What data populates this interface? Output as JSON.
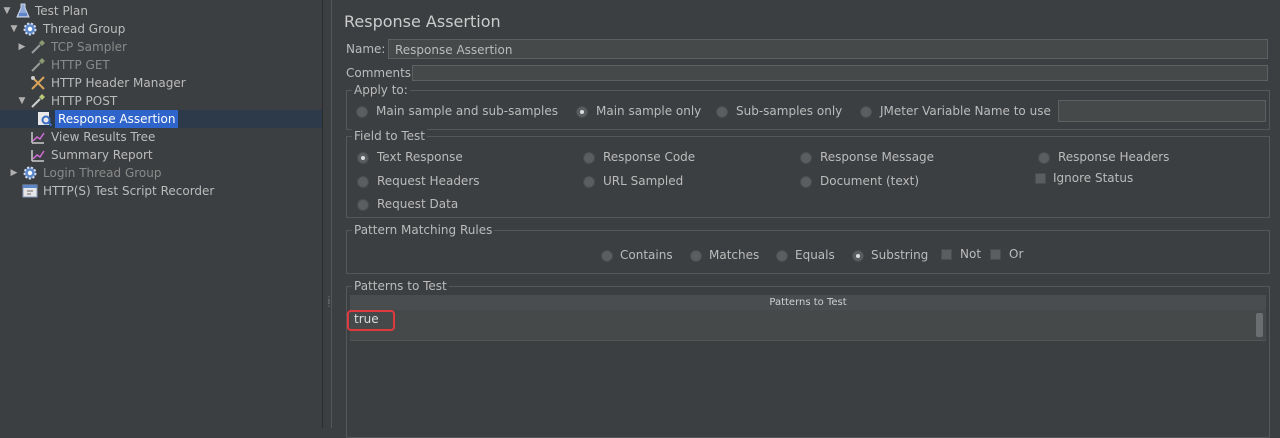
{
  "tree": {
    "items": [
      {
        "label": "Test Plan",
        "icon": "flask-icon"
      },
      {
        "label": "Thread Group",
        "icon": "gear-icon"
      },
      {
        "label": "TCP Sampler",
        "icon": "pipette-icon"
      },
      {
        "label": "HTTP GET",
        "icon": "pipette-icon"
      },
      {
        "label": "HTTP Header Manager",
        "icon": "wrench-icon"
      },
      {
        "label": "HTTP POST",
        "icon": "pipette-icon"
      },
      {
        "label": "Response Assertion",
        "icon": "magnifier-icon"
      },
      {
        "label": "View Results Tree",
        "icon": "chart-icon"
      },
      {
        "label": "Summary Report",
        "icon": "chart-icon"
      },
      {
        "label": "Login Thread Group",
        "icon": "gear-icon"
      },
      {
        "label": "HTTP(S) Test Script Recorder",
        "icon": "recorder-icon"
      }
    ]
  },
  "panel": {
    "title": "Response Assertion",
    "name_label": "Name:",
    "name_value": "Response Assertion",
    "comments_label": "Comments:",
    "apply_to": {
      "title": "Apply to:",
      "options": [
        "Main sample and sub-samples",
        "Main sample only",
        "Sub-samples only",
        "JMeter Variable Name to use"
      ],
      "selected": "Main sample only"
    },
    "field_to_test": {
      "title": "Field to Test",
      "options": [
        "Text Response",
        "Response Code",
        "Response Message",
        "Response Headers",
        "Request Headers",
        "URL Sampled",
        "Document (text)",
        "Request Data"
      ],
      "ignore_status": "Ignore Status",
      "selected": "Text Response"
    },
    "pattern_rules": {
      "title": "Pattern Matching Rules",
      "options": [
        "Contains",
        "Matches",
        "Equals",
        "Substring"
      ],
      "not_label": "Not",
      "or_label": "Or",
      "selected": "Substring"
    },
    "patterns": {
      "title": "Patterns to Test",
      "column_header": "Patterns to Test",
      "rows": [
        "true"
      ]
    }
  }
}
